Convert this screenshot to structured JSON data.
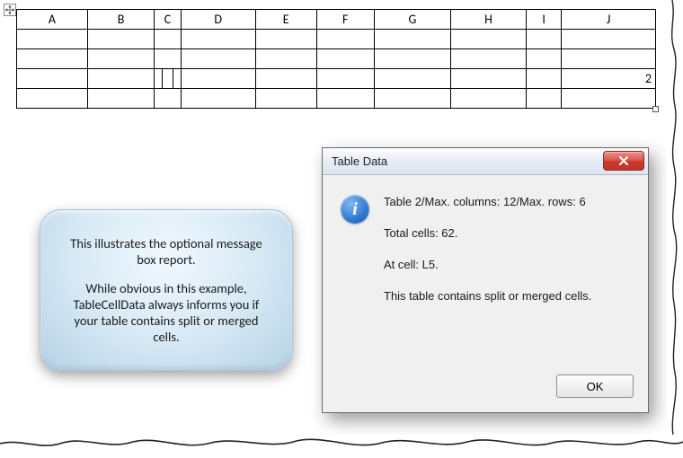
{
  "table": {
    "headers": [
      "A",
      "B",
      "C",
      "D",
      "E",
      "F",
      "G",
      "H",
      "I",
      "J"
    ],
    "value_row4_colJ": "2"
  },
  "callout": {
    "p1": "This illustrates the optional message box report.",
    "p2": "While obvious in this example, TableCellData always informs you if your table contains split or merged cells."
  },
  "dialog": {
    "title": "Table Data",
    "line1": "Table 2/Max. columns: 12/Max. rows: 6",
    "line2": "Total cells: 62.",
    "line3": "At cell: L5.",
    "line4": "This table contains split or merged cells.",
    "ok_label": "OK"
  },
  "chart_data": {
    "type": "table",
    "title": "Table Data report",
    "table_index": 2,
    "max_columns": 12,
    "max_rows": 6,
    "total_cells": 62,
    "at_cell": "L5",
    "has_split_or_merged": true,
    "visible_headers": [
      "A",
      "B",
      "C",
      "D",
      "E",
      "F",
      "G",
      "H",
      "I",
      "J"
    ],
    "visible_rows": 5,
    "split_cells_at": [
      {
        "row": 4,
        "col": "C",
        "parts": 3
      }
    ],
    "filled_cells": [
      {
        "row": 4,
        "col": "J",
        "value": 2
      }
    ]
  }
}
